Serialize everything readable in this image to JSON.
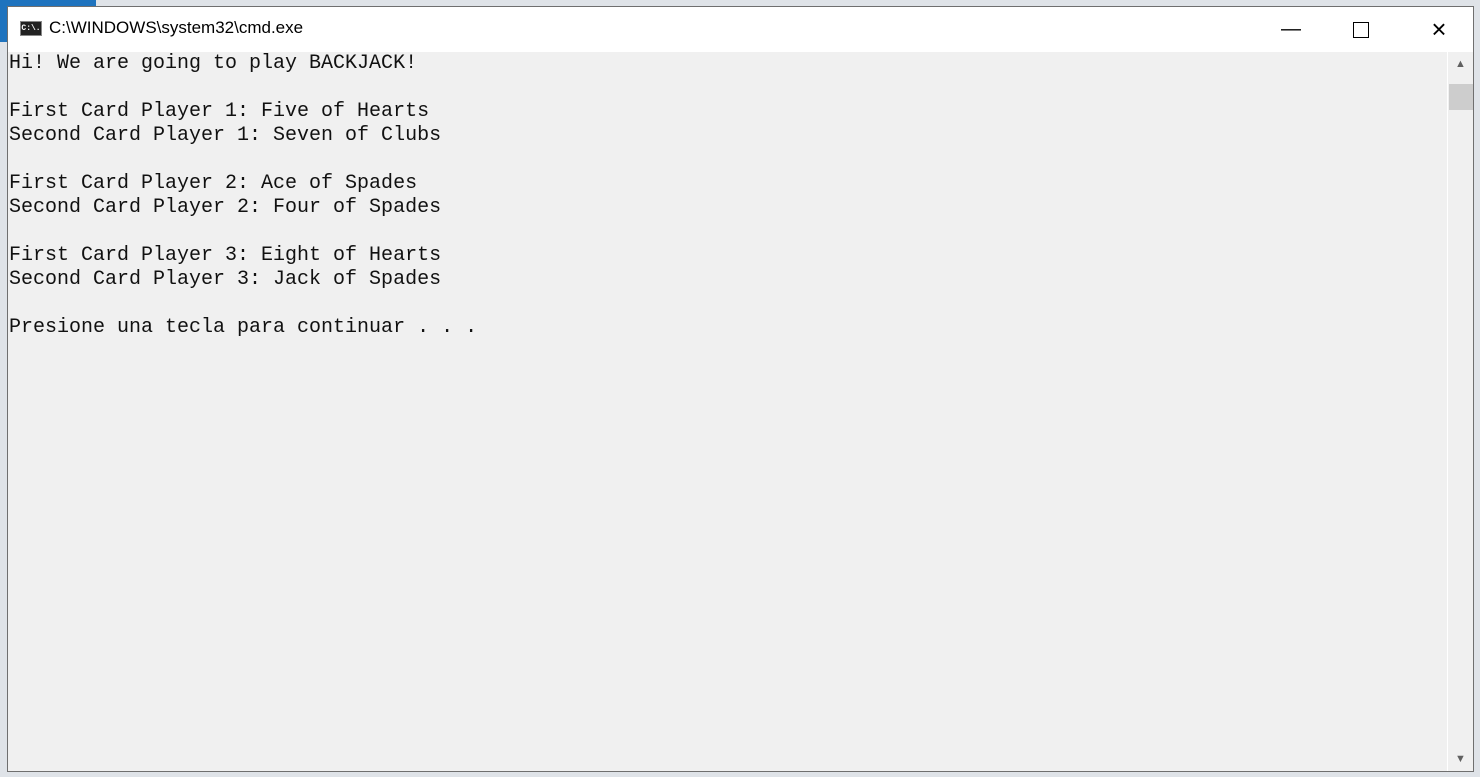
{
  "window": {
    "title": "C:\\WINDOWS\\system32\\cmd.exe",
    "icon_label": "C:\\."
  },
  "console": {
    "lines": [
      "Hi! We are going to play BACKJACK!",
      "",
      "First Card Player 1: Five of Hearts",
      "Second Card Player 1: Seven of Clubs",
      "",
      "First Card Player 2: Ace of Spades",
      "Second Card Player 2: Four of Spades",
      "",
      "First Card Player 3: Eight of Hearts",
      "Second Card Player 3: Jack of Spades",
      "",
      "Presione una tecla para continuar . . ."
    ]
  },
  "icons": {
    "minimize": "minimize-icon",
    "maximize": "maximize-icon",
    "close": "close-icon"
  }
}
